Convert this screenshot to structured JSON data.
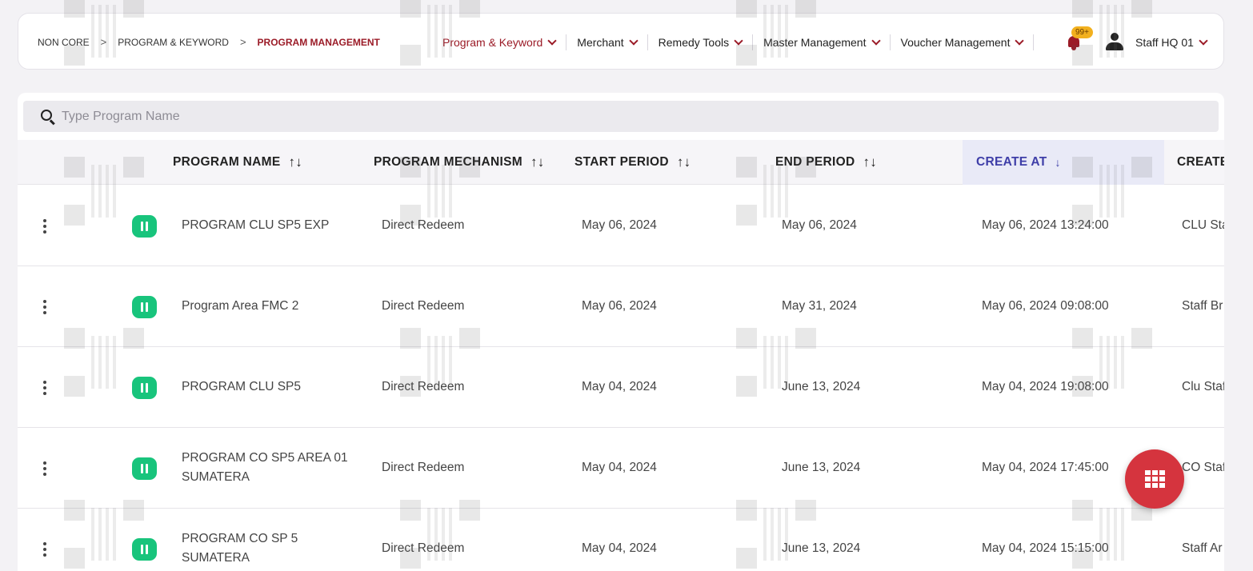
{
  "breadcrumb": {
    "items": [
      "NON CORE",
      "PROGRAM & KEYWORD",
      "PROGRAM MANAGEMENT"
    ]
  },
  "nav": {
    "items": [
      "Program & Keyword",
      "Merchant",
      "Remedy Tools",
      "Master Management",
      "Voucher Management"
    ]
  },
  "notifications": {
    "badge": "99+"
  },
  "user": {
    "name": "Staff HQ 01"
  },
  "search": {
    "placeholder": "Type Program Name",
    "value": ""
  },
  "table": {
    "columns": [
      "PROGRAM NAME",
      "PROGRAM MECHANISM",
      "START PERIOD",
      "END PERIOD",
      "CREATE AT",
      "CREATE"
    ],
    "sort_icon": "↑↓",
    "active_sort_icon": "↓",
    "rows": [
      {
        "name": "PROGRAM CLU SP5 EXP",
        "mechanism": "Direct Redeem",
        "start": "May 06, 2024",
        "end": "May 06, 2024",
        "created_at": "May 06, 2024 13:24:00",
        "created_by": "CLU Sta"
      },
      {
        "name": "Program Area FMC 2",
        "mechanism": "Direct Redeem",
        "start": "May 06, 2024",
        "end": "May 31, 2024",
        "created_at": "May 06, 2024 09:08:00",
        "created_by": "Staff Br"
      },
      {
        "name": "PROGRAM CLU SP5",
        "mechanism": "Direct Redeem",
        "start": "May 04, 2024",
        "end": "June 13, 2024",
        "created_at": "May 04, 2024 19:08:00",
        "created_by": "Clu Staf"
      },
      {
        "name": "PROGRAM CO SP5 AREA 01 SUMATERA",
        "mechanism": "Direct Redeem",
        "start": "May 04, 2024",
        "end": "June 13, 2024",
        "created_at": "May 04, 2024 17:45:00",
        "created_by": "CO Staf"
      },
      {
        "name": "PROGRAM CO SP 5 SUMATERA",
        "mechanism": "Direct Redeem",
        "start": "May 04, 2024",
        "end": "June 13, 2024",
        "created_at": "May 04, 2024 15:15:00",
        "created_by": "Staff Ar"
      }
    ]
  },
  "colors": {
    "brand": "#9b1b27",
    "status_active": "#18c47c",
    "fab": "#d5343e",
    "active_sort": "#3e3ea8"
  },
  "icons": {
    "search": "search-icon",
    "notification": "bell-icon",
    "user": "user-icon",
    "row_menu": "kebab-icon",
    "status": "pause-icon",
    "fab": "grid-icon"
  }
}
